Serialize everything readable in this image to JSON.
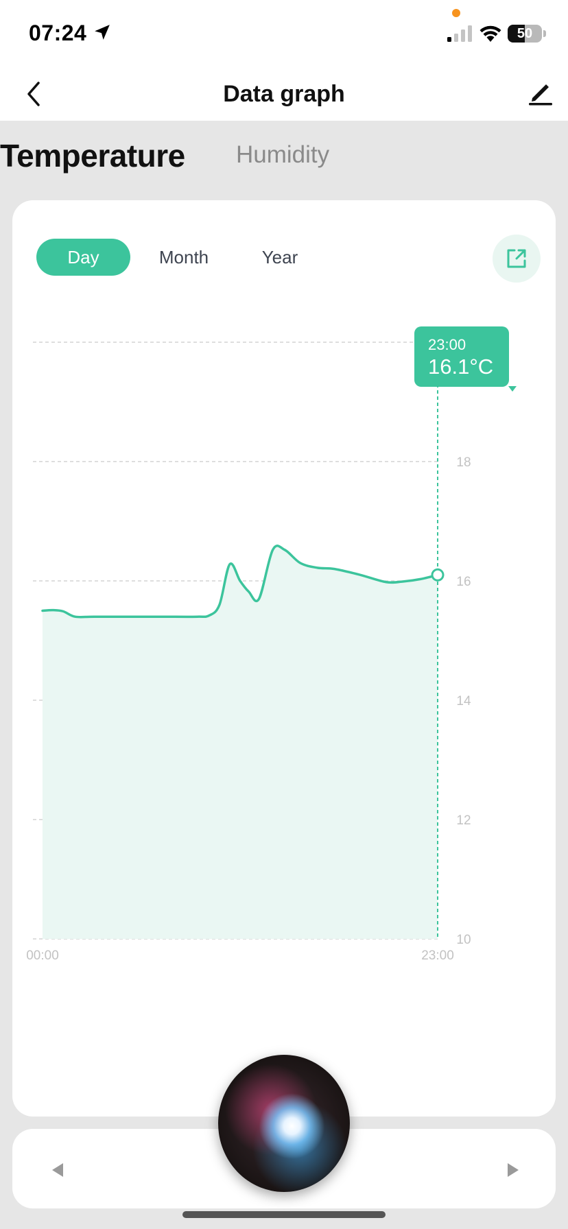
{
  "status_bar": {
    "time": "07:24",
    "battery": "50",
    "battery_level": 0.5
  },
  "header": {
    "title": "Data graph"
  },
  "tabs": {
    "temperature": "Temperature",
    "humidity": "Humidity",
    "active": "Temperature"
  },
  "range_tabs": {
    "day": "Day",
    "month": "Month",
    "year": "Year",
    "active": "Day"
  },
  "tooltip": {
    "time": "23:00",
    "value": "16.1°C"
  },
  "colors": {
    "accent": "#3cc49c",
    "area_fill": "#eaf7f3",
    "grid": "#d4d4d4",
    "tick": "#c2c2c2"
  },
  "icons": {
    "back": "chevron-left-icon",
    "edit": "pencil-icon",
    "share": "external-link-icon",
    "prev": "triangle-left-icon",
    "next": "triangle-right-icon"
  },
  "chart_data": {
    "type": "area",
    "x_range": [
      0,
      23
    ],
    "x_tick_labels": [
      "00:00",
      "23:00"
    ],
    "x": [
      0,
      0.6,
      1.2,
      1.9,
      3,
      5,
      7,
      9,
      9.7,
      10.3,
      10.9,
      11.5,
      12,
      12.6,
      13.4,
      14.1,
      15,
      16,
      17,
      18.5,
      20,
      21,
      22,
      23
    ],
    "y": [
      15.5,
      15.51,
      15.49,
      15.4,
      15.4,
      15.4,
      15.4,
      15.4,
      15.42,
      15.6,
      16.28,
      16.0,
      15.82,
      15.7,
      16.52,
      16.52,
      16.3,
      16.22,
      16.2,
      16.1,
      15.98,
      15.99,
      16.03,
      16.1
    ],
    "ylim": [
      10,
      20
    ],
    "y_ticks": [
      10,
      12,
      14,
      16,
      18,
      20
    ],
    "grid": true,
    "highlight": {
      "x": 23,
      "y": 16.1
    }
  }
}
